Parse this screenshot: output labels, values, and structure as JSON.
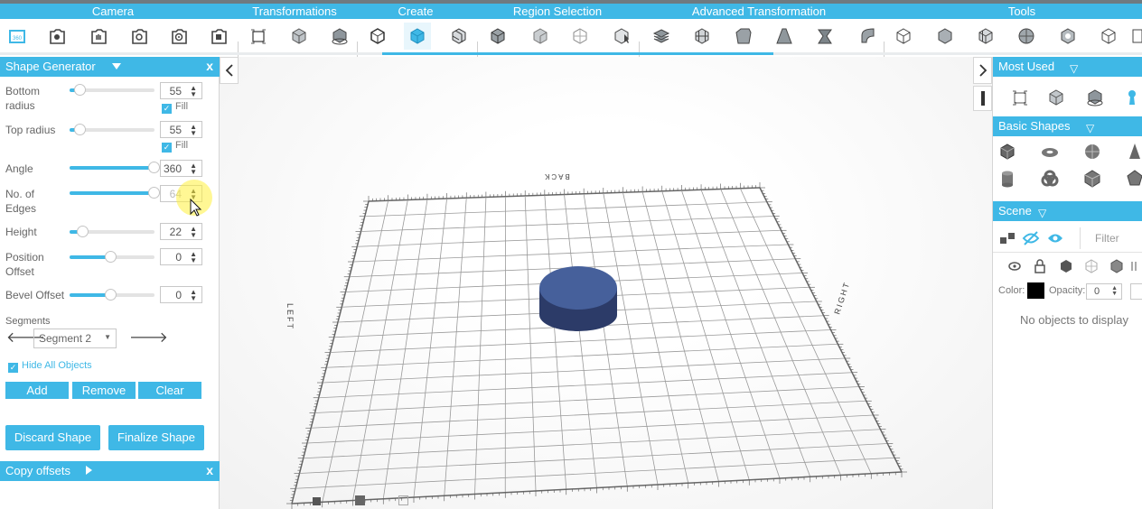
{
  "menu": {
    "categories": [
      "Camera",
      "Transformations",
      "Create",
      "Region Selection",
      "Advanced Transformation",
      "Tools"
    ],
    "accent": "#3fb8e6",
    "active_tool": "cylinder-tool"
  },
  "shape_generator": {
    "title": "Shape Generator",
    "close": "x",
    "params": [
      {
        "label": "Bottom radius",
        "value": "55",
        "level": 0.12,
        "fill_label": "Fill"
      },
      {
        "label": "Top radius",
        "value": "55",
        "level": 0.12,
        "fill_label": "Fill"
      },
      {
        "label": "Angle",
        "value": "360",
        "level": 1.0
      },
      {
        "label": "No. of Edges",
        "value": "64",
        "level": 1.0
      },
      {
        "label": "Height",
        "value": "22",
        "level": 0.15
      },
      {
        "label": "Position Offset",
        "value": "0",
        "level": 0.5
      },
      {
        "label": "Bevel Offset",
        "value": "0",
        "level": 0.5
      }
    ],
    "segments_label": "Segments",
    "segment_selected": "Segment 2",
    "hide_all_label": "Hide All Objects",
    "add_label": "Add",
    "remove_label": "Remove",
    "clear_label": "Clear",
    "discard_label": "Discard Shape",
    "finalize_label": "Finalize Shape"
  },
  "copy_offsets": {
    "title": "Copy offsets",
    "close": "x"
  },
  "viewport": {
    "labels": {
      "back": "BACK",
      "left": "LEFT",
      "right": "RIGHT"
    },
    "shape_color": "#46609b"
  },
  "right": {
    "most_used": "Most Used",
    "basic_shapes": "Basic Shapes",
    "scene": "Scene",
    "filter_placeholder": "Filter",
    "color_label": "Color:",
    "opacity_label": "Opacity:",
    "opacity_value": "0",
    "empty": "No objects to display"
  }
}
